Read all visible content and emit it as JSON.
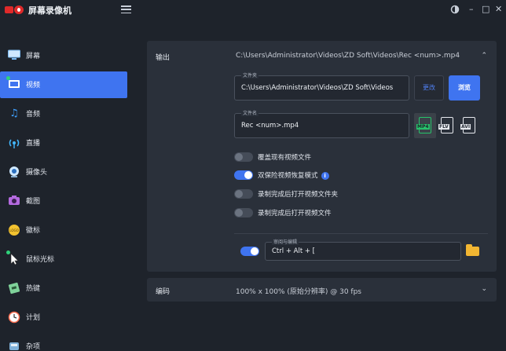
{
  "app": {
    "title": "屏幕录像机"
  },
  "titlebar": {
    "theme_icon": "theme-toggle-icon",
    "minimize": "–",
    "maximize": "□",
    "close": "✕"
  },
  "sidebar": {
    "items": [
      {
        "label": "屏幕",
        "icon": "monitor-icon",
        "glyph": "▭",
        "color": "#9fd0ff"
      },
      {
        "label": "视频",
        "icon": "video-icon",
        "glyph": "🎞",
        "color": "#ffffff"
      },
      {
        "label": "音频",
        "icon": "music-note-icon",
        "glyph": "♫",
        "color": "#3fa0ff"
      },
      {
        "label": "直播",
        "icon": "broadcast-icon",
        "glyph": "◉",
        "color": "#43b8ff"
      },
      {
        "label": "摄像头",
        "icon": "webcam-icon",
        "glyph": "◎",
        "color": "#8ad0ff"
      },
      {
        "label": "截图",
        "icon": "camera-icon",
        "glyph": "◙",
        "color": "#b46adf"
      },
      {
        "label": "徽标",
        "icon": "logo-badge-icon",
        "glyph": "●",
        "color": "#f2c230"
      },
      {
        "label": "鼠标光标",
        "icon": "cursor-icon",
        "glyph": "➤",
        "color": "#ffffff"
      },
      {
        "label": "热键",
        "icon": "keyboard-icon",
        "glyph": "⌨",
        "color": "#7fd29a"
      },
      {
        "label": "计划",
        "icon": "clock-icon",
        "glyph": "◷",
        "color": "#ff6d4f"
      },
      {
        "label": "杂项",
        "icon": "misc-icon",
        "glyph": "⚙",
        "color": "#c8ced8"
      }
    ]
  },
  "output": {
    "title": "输出",
    "path_summary": "C:\\Users\\Administrator\\Videos\\ZD Soft\\Videos\\Rec <num>.mp4",
    "folder_label": "文件夹",
    "folder_value": "C:\\Users\\Administrator\\Videos\\ZD Soft\\Videos",
    "change_button": "更改",
    "browse_button": "浏览",
    "filename_label": "文件名",
    "filename_value": "Rec <num>.mp4",
    "formats": [
      "MP4",
      "FLV",
      "AVI"
    ],
    "options": [
      {
        "label": "覆盖现有视频文件",
        "on": false
      },
      {
        "label": "双保险视频恢复模式",
        "on": true
      },
      {
        "label": "录制完成后打开视频文件夹",
        "on": false
      },
      {
        "label": "录制完成后打开视频文件",
        "on": false
      }
    ],
    "info_glyph": "i",
    "hotkey_label": "审阅与编辑",
    "hotkey_value": "Ctrl + Alt + ["
  },
  "encoding": {
    "title": "编码",
    "summary": "100% x 100% (原始分辨率) @ 30 fps"
  }
}
